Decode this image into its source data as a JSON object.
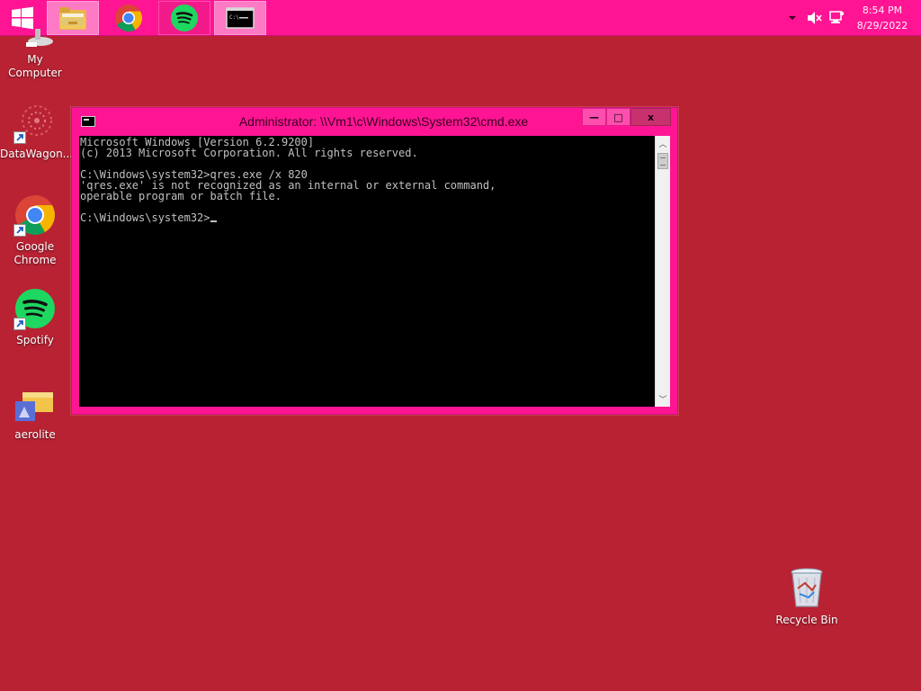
{
  "taskbar": {
    "apps": [
      {
        "name": "File Explorer"
      },
      {
        "name": "Google Chrome"
      },
      {
        "name": "Spotify"
      },
      {
        "name": "Command Prompt"
      }
    ],
    "clock": {
      "time": "8:54 PM",
      "date": "8/29/2022"
    }
  },
  "desktop": {
    "icons": [
      {
        "label": "My Computer"
      },
      {
        "label": "DataWagon..."
      },
      {
        "label": "Google Chrome"
      },
      {
        "label": "Spotify"
      },
      {
        "label": "aerolite"
      },
      {
        "label": "Recycle Bin"
      }
    ]
  },
  "cmd": {
    "title": "Administrator: \\\\Vm1\\c\\Windows\\System32\\cmd.exe",
    "lines": [
      "Microsoft Windows [Version 6.2.9200]",
      "(c) 2013 Microsoft Corporation. All rights reserved.",
      "",
      "C:\\Windows\\system32>qres.exe /x 820",
      "'qres.exe' is not recognized as an internal or external command,",
      "operable program or batch file.",
      "",
      "C:\\Windows\\system32>"
    ],
    "minimize_glyph": "—",
    "maximize_glyph": "□",
    "close_glyph": "x",
    "scroll_up_glyph": "︿",
    "scroll_down_glyph": "﹀"
  },
  "colors": {
    "desktop_bg": "#b82233",
    "taskbar_bg": "#ff1493",
    "window_frame": "#ff1493",
    "console_bg": "#000000",
    "console_text": "#c0c0c0"
  }
}
